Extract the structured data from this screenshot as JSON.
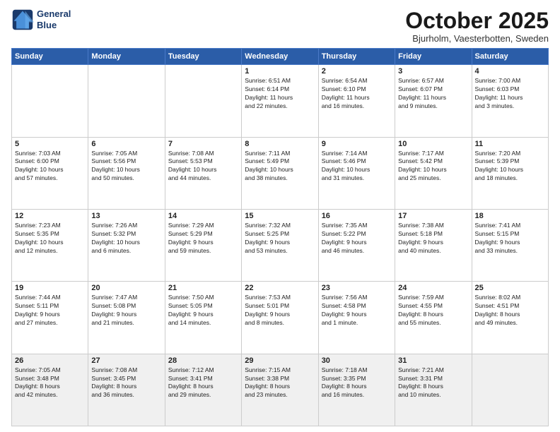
{
  "logo": {
    "line1": "General",
    "line2": "Blue"
  },
  "title": "October 2025",
  "location": "Bjurholm, Vaesterbotten, Sweden",
  "weekdays": [
    "Sunday",
    "Monday",
    "Tuesday",
    "Wednesday",
    "Thursday",
    "Friday",
    "Saturday"
  ],
  "weeks": [
    [
      {
        "day": "",
        "info": ""
      },
      {
        "day": "",
        "info": ""
      },
      {
        "day": "",
        "info": ""
      },
      {
        "day": "1",
        "info": "Sunrise: 6:51 AM\nSunset: 6:14 PM\nDaylight: 11 hours\nand 22 minutes."
      },
      {
        "day": "2",
        "info": "Sunrise: 6:54 AM\nSunset: 6:10 PM\nDaylight: 11 hours\nand 16 minutes."
      },
      {
        "day": "3",
        "info": "Sunrise: 6:57 AM\nSunset: 6:07 PM\nDaylight: 11 hours\nand 9 minutes."
      },
      {
        "day": "4",
        "info": "Sunrise: 7:00 AM\nSunset: 6:03 PM\nDaylight: 11 hours\nand 3 minutes."
      }
    ],
    [
      {
        "day": "5",
        "info": "Sunrise: 7:03 AM\nSunset: 6:00 PM\nDaylight: 10 hours\nand 57 minutes."
      },
      {
        "day": "6",
        "info": "Sunrise: 7:05 AM\nSunset: 5:56 PM\nDaylight: 10 hours\nand 50 minutes."
      },
      {
        "day": "7",
        "info": "Sunrise: 7:08 AM\nSunset: 5:53 PM\nDaylight: 10 hours\nand 44 minutes."
      },
      {
        "day": "8",
        "info": "Sunrise: 7:11 AM\nSunset: 5:49 PM\nDaylight: 10 hours\nand 38 minutes."
      },
      {
        "day": "9",
        "info": "Sunrise: 7:14 AM\nSunset: 5:46 PM\nDaylight: 10 hours\nand 31 minutes."
      },
      {
        "day": "10",
        "info": "Sunrise: 7:17 AM\nSunset: 5:42 PM\nDaylight: 10 hours\nand 25 minutes."
      },
      {
        "day": "11",
        "info": "Sunrise: 7:20 AM\nSunset: 5:39 PM\nDaylight: 10 hours\nand 18 minutes."
      }
    ],
    [
      {
        "day": "12",
        "info": "Sunrise: 7:23 AM\nSunset: 5:35 PM\nDaylight: 10 hours\nand 12 minutes."
      },
      {
        "day": "13",
        "info": "Sunrise: 7:26 AM\nSunset: 5:32 PM\nDaylight: 10 hours\nand 6 minutes."
      },
      {
        "day": "14",
        "info": "Sunrise: 7:29 AM\nSunset: 5:29 PM\nDaylight: 9 hours\nand 59 minutes."
      },
      {
        "day": "15",
        "info": "Sunrise: 7:32 AM\nSunset: 5:25 PM\nDaylight: 9 hours\nand 53 minutes."
      },
      {
        "day": "16",
        "info": "Sunrise: 7:35 AM\nSunset: 5:22 PM\nDaylight: 9 hours\nand 46 minutes."
      },
      {
        "day": "17",
        "info": "Sunrise: 7:38 AM\nSunset: 5:18 PM\nDaylight: 9 hours\nand 40 minutes."
      },
      {
        "day": "18",
        "info": "Sunrise: 7:41 AM\nSunset: 5:15 PM\nDaylight: 9 hours\nand 33 minutes."
      }
    ],
    [
      {
        "day": "19",
        "info": "Sunrise: 7:44 AM\nSunset: 5:11 PM\nDaylight: 9 hours\nand 27 minutes."
      },
      {
        "day": "20",
        "info": "Sunrise: 7:47 AM\nSunset: 5:08 PM\nDaylight: 9 hours\nand 21 minutes."
      },
      {
        "day": "21",
        "info": "Sunrise: 7:50 AM\nSunset: 5:05 PM\nDaylight: 9 hours\nand 14 minutes."
      },
      {
        "day": "22",
        "info": "Sunrise: 7:53 AM\nSunset: 5:01 PM\nDaylight: 9 hours\nand 8 minutes."
      },
      {
        "day": "23",
        "info": "Sunrise: 7:56 AM\nSunset: 4:58 PM\nDaylight: 9 hours\nand 1 minute."
      },
      {
        "day": "24",
        "info": "Sunrise: 7:59 AM\nSunset: 4:55 PM\nDaylight: 8 hours\nand 55 minutes."
      },
      {
        "day": "25",
        "info": "Sunrise: 8:02 AM\nSunset: 4:51 PM\nDaylight: 8 hours\nand 49 minutes."
      }
    ],
    [
      {
        "day": "26",
        "info": "Sunrise: 7:05 AM\nSunset: 3:48 PM\nDaylight: 8 hours\nand 42 minutes."
      },
      {
        "day": "27",
        "info": "Sunrise: 7:08 AM\nSunset: 3:45 PM\nDaylight: 8 hours\nand 36 minutes."
      },
      {
        "day": "28",
        "info": "Sunrise: 7:12 AM\nSunset: 3:41 PM\nDaylight: 8 hours\nand 29 minutes."
      },
      {
        "day": "29",
        "info": "Sunrise: 7:15 AM\nSunset: 3:38 PM\nDaylight: 8 hours\nand 23 minutes."
      },
      {
        "day": "30",
        "info": "Sunrise: 7:18 AM\nSunset: 3:35 PM\nDaylight: 8 hours\nand 16 minutes."
      },
      {
        "day": "31",
        "info": "Sunrise: 7:21 AM\nSunset: 3:31 PM\nDaylight: 8 hours\nand 10 minutes."
      },
      {
        "day": "",
        "info": ""
      }
    ]
  ]
}
